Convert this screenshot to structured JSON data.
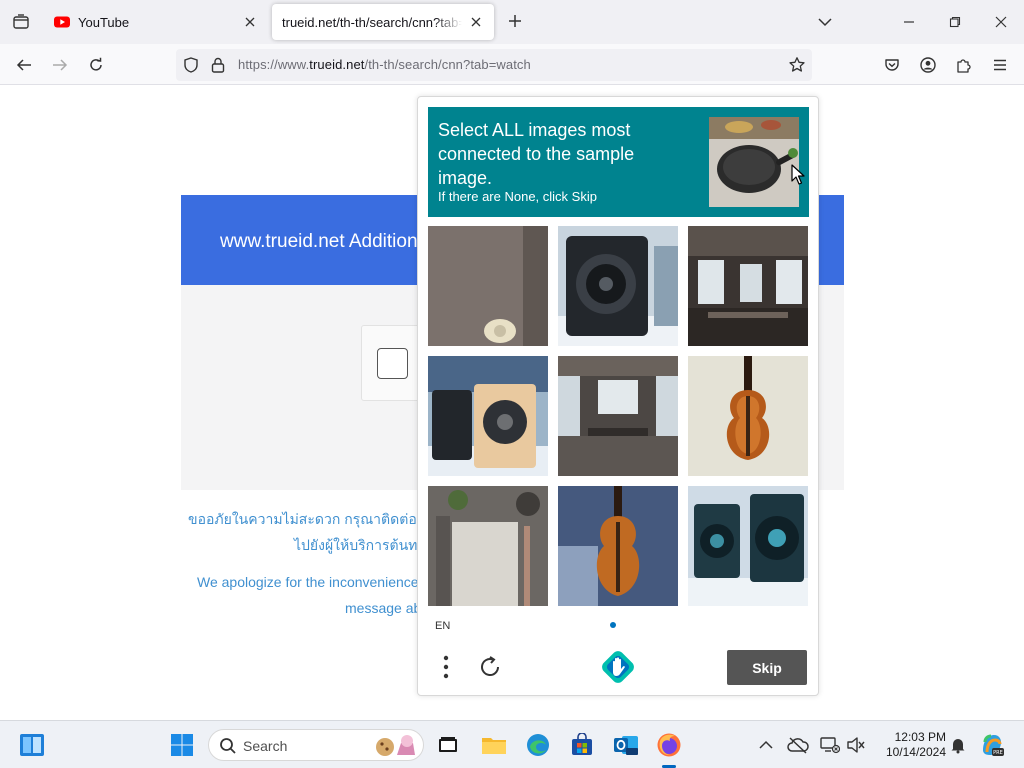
{
  "browser": {
    "tabs": [
      {
        "title": "YouTube",
        "active": false
      },
      {
        "title": "trueid.net/th-th/search/cnn?tab=watch",
        "active": true
      }
    ],
    "url": {
      "prefix": "https://www.",
      "host": "trueid.net",
      "path": "/th-th/search/cnn?tab=watch"
    }
  },
  "page": {
    "banner_title": "www.trueid.net Additional Verification Required",
    "apology_th_line1": "ขออภัยในความไม่สะดวก กรุณาติดต่อผู้ให้บริการ หากปัญหายังคงอยู่ กรุณาส่งภาพ",
    "apology_th_line2": "ไปยังผู้ให้บริการต้นทาง",
    "apology_en_line1": "We apologize for the inconvenience. Please contact the service provider if this problem persists, or",
    "apology_en_line2": "message above to the origin provider."
  },
  "captcha": {
    "prompt_main": "Select ALL images most connected to the sample image.",
    "prompt_sub": "If there are None, click Skip",
    "sample_image": "cast-iron-skillet-photo",
    "grid": [
      "door-knob-photo",
      "speaker-photo",
      "restaurant-interior-photo",
      "speakers-snow-photo",
      "cafeteria-photo",
      "violin-photo",
      "notebook-photo",
      "violin-painting-photo",
      "speakers-pair-photo"
    ],
    "language": "EN",
    "skip_label": "Skip",
    "accent_color": "#00838f"
  },
  "taskbar": {
    "search_placeholder": "Search",
    "time": "12:03 PM",
    "date": "10/14/2024"
  }
}
